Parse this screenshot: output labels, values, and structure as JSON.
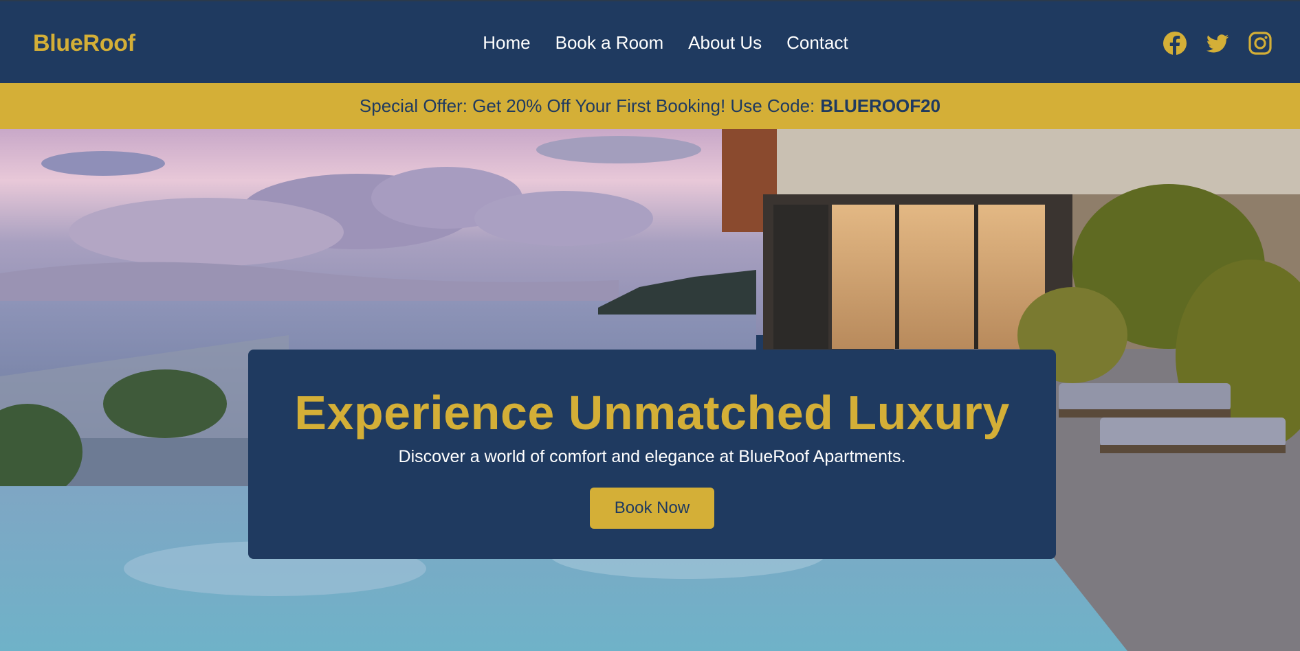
{
  "header": {
    "brand": "BlueRoof",
    "nav": [
      "Home",
      "Book a Room",
      "About Us",
      "Contact"
    ],
    "socials": [
      "facebook-icon",
      "twitter-icon",
      "instagram-icon"
    ]
  },
  "promo": {
    "text": "Special Offer: Get 20% Off Your First Booking! Use Code:",
    "code": "BLUEROOF20"
  },
  "hero": {
    "title": "Experience Unmatched Luxury",
    "subtitle": "Discover a world of comfort and elegance at BlueRoof Apartments.",
    "button": "Book Now"
  },
  "colors": {
    "primary": "#1f3a60",
    "accent": "#d4af37",
    "text_light": "#ffffff"
  }
}
